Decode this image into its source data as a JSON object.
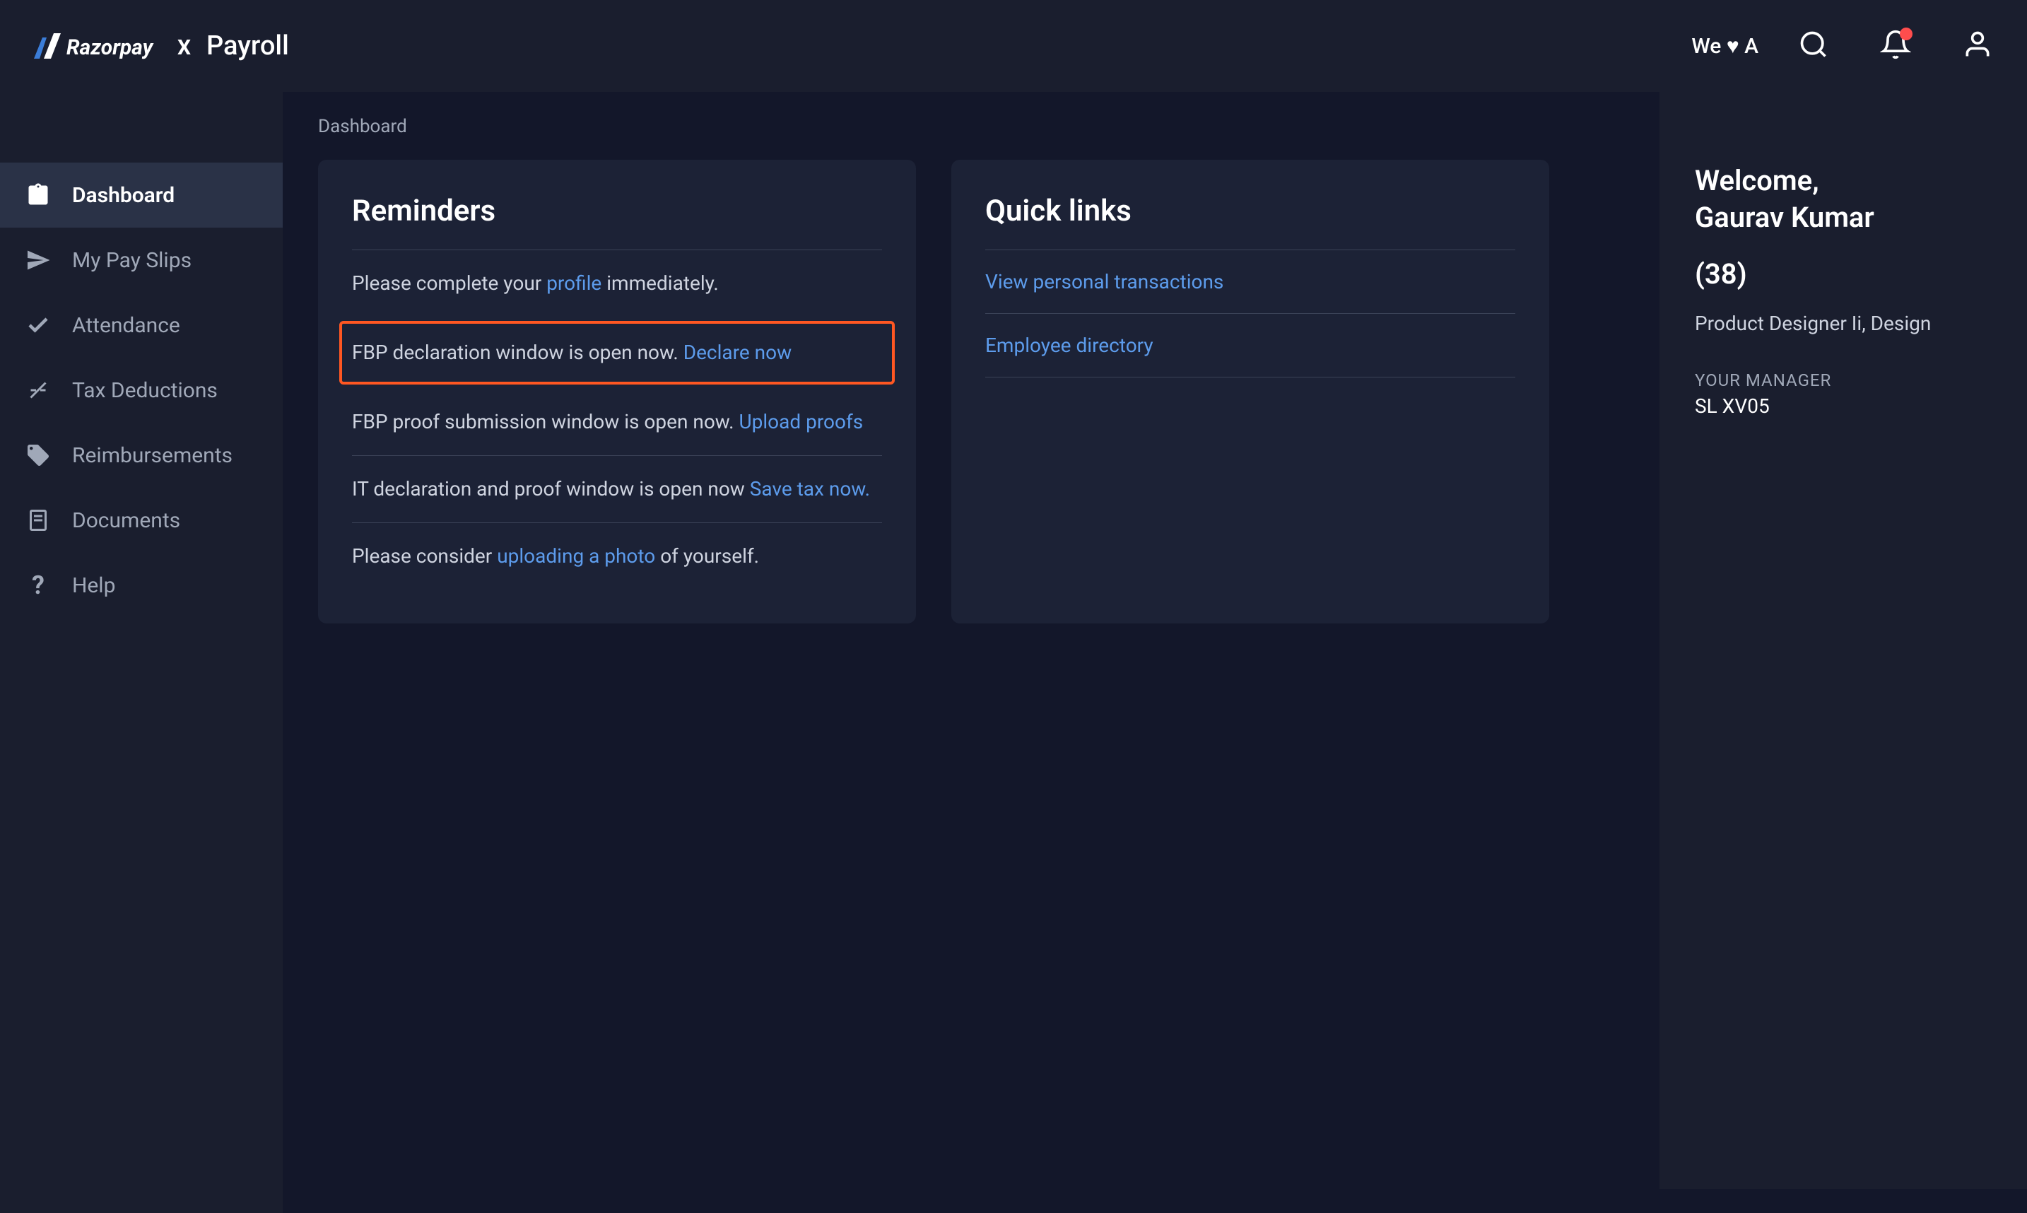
{
  "header": {
    "product_name": "Payroll",
    "tagline": "We ♥ A"
  },
  "breadcrumb": "Dashboard",
  "sidebar": {
    "items": [
      {
        "label": "Dashboard",
        "active": true
      },
      {
        "label": "My Pay Slips",
        "active": false
      },
      {
        "label": "Attendance",
        "active": false
      },
      {
        "label": "Tax Deductions",
        "active": false
      },
      {
        "label": "Reimbursements",
        "active": false
      },
      {
        "label": "Documents",
        "active": false
      },
      {
        "label": "Help",
        "active": false
      }
    ]
  },
  "reminders": {
    "title": "Reminders",
    "items": {
      "profile_pre": "Please complete your ",
      "profile_link": "profile",
      "profile_post": " immediately.",
      "fbp_declare_pre": "FBP declaration window is open now. ",
      "fbp_declare_link": "Declare now",
      "fbp_proof_pre": "FBP proof submission window is open now. ",
      "fbp_proof_link": "Upload proofs",
      "it_declare_pre": "IT declaration and proof window is open now ",
      "it_declare_link": "Save tax now.",
      "photo_pre": "Please consider ",
      "photo_link": "uploading a photo",
      "photo_post": " of yourself."
    }
  },
  "quicklinks": {
    "title": "Quick links",
    "items": [
      {
        "label": "View personal transactions"
      },
      {
        "label": "Employee directory"
      }
    ]
  },
  "profile": {
    "welcome": "Welcome,",
    "name": "Gaurav Kumar",
    "id": "(38)",
    "role": "Product Designer Ii, Design",
    "manager_label": "YOUR MANAGER",
    "manager_name": "SL XV05"
  }
}
